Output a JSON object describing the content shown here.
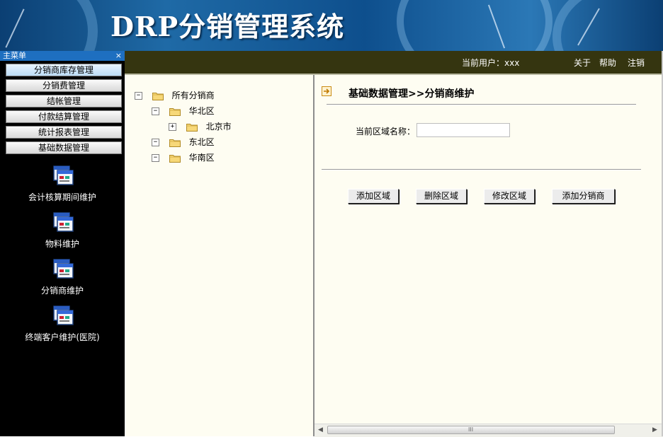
{
  "app": {
    "title": "DRP分销管理系统",
    "brand_colors": {
      "banner": "#1f6aa6",
      "infobar": "#353510",
      "menu_bg": "#000000",
      "panel_bg": "#fefdf2"
    }
  },
  "infobar": {
    "user": "当前用户：xxx",
    "links": [
      "关于",
      "帮助",
      "注销"
    ]
  },
  "sidebar": {
    "header": "主菜单",
    "close_glyph": "×",
    "menu": [
      {
        "label": "分销商库存管理",
        "active": true
      },
      {
        "label": "分销费管理"
      },
      {
        "label": "结帐管理"
      },
      {
        "label": "付款结算管理"
      },
      {
        "label": "统计报表管理"
      },
      {
        "label": "基础数据管理"
      }
    ],
    "icons": [
      {
        "label": "会计核算期间维护",
        "icon": "window-icon"
      },
      {
        "label": "物料维护",
        "icon": "window-icon"
      },
      {
        "label": "分销商维护",
        "icon": "window-icon"
      },
      {
        "label": "终端客户维护(医院)",
        "icon": "window-icon"
      }
    ]
  },
  "tree": {
    "nodes": [
      {
        "label": "所有分销商",
        "toggle": "−",
        "level": 0
      },
      {
        "label": "华北区",
        "toggle": "−",
        "level": 1
      },
      {
        "label": "北京市",
        "toggle": "+",
        "level": 2
      },
      {
        "label": "东北区",
        "toggle": "−",
        "level": 1
      },
      {
        "label": "华南区",
        "toggle": "−",
        "level": 1
      }
    ]
  },
  "content": {
    "title": "基础数据管理>>分销商维护",
    "field_label": "当前区域名称：",
    "field_value": "",
    "buttons": [
      "添加区域",
      "删除区域",
      "修改区域",
      "添加分销商"
    ]
  },
  "scrollbar": {
    "grip": "III"
  }
}
